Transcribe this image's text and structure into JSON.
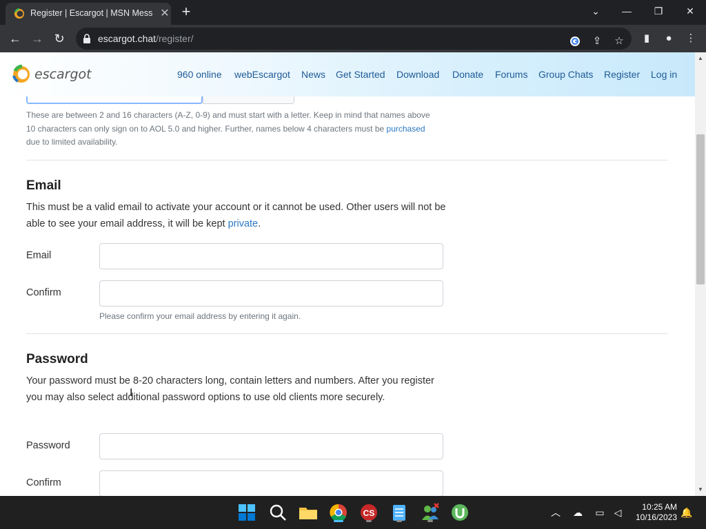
{
  "browser": {
    "tab_title": "Register | Escargot | MSN Messenger",
    "url_host": "escargot.chat",
    "url_path": "/register/"
  },
  "header": {
    "brand": "escargot",
    "nav": [
      "960 online",
      "webEscargot",
      "News",
      "Get Started",
      "Download",
      "Donate",
      "Forums",
      "Group Chats",
      "Register",
      "Log in"
    ]
  },
  "username_hint": {
    "part1": "These are between 2 and 16 characters (A-Z, 0-9) and must start with a letter. Keep in mind that names above 10 characters can only sign on to AOL 5.0 and higher. Further, names below 4 characters must be ",
    "link": "purchased",
    "part2": " due to limited availability."
  },
  "email_section": {
    "heading": "Email",
    "desc_part1": "This must be a valid email to activate your account or it cannot be used. Other users will not be able to see your email address, it will be kept ",
    "desc_link": "private",
    "desc_part2": ".",
    "email_label": "Email",
    "confirm_label": "Confirm",
    "confirm_hint": "Please confirm your email address by entering it again."
  },
  "password_section": {
    "heading": "Password",
    "desc": "Your password must be 8-20 characters long, contain letters and numbers. After you register you may also select additional password options to use old clients more securely.",
    "password_label": "Password",
    "confirm_label": "Confirm"
  },
  "taskbar": {
    "time": "10:25 AM",
    "date": "10/16/2023"
  }
}
